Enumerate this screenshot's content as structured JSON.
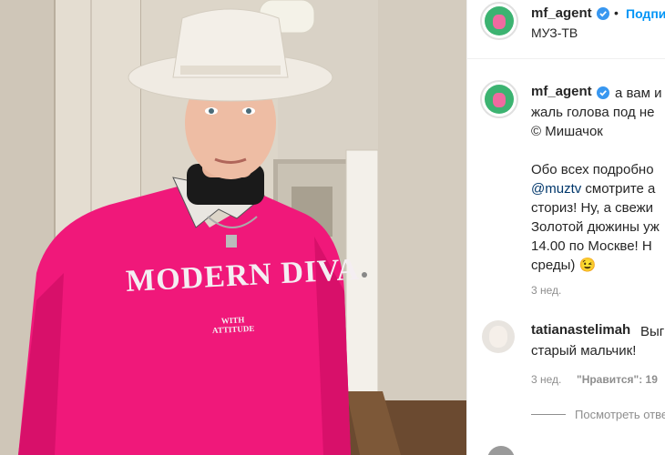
{
  "post_header": {
    "username": "mf_agent",
    "separator": "•",
    "follow_label": "Подпи",
    "location": "МУЗ-ТВ"
  },
  "caption": {
    "username": "mf_agent",
    "line1": "а вам и",
    "line2": "жаль голова под не",
    "line3": "© Мишачок",
    "line4": "Обо всех подробно",
    "mention": "@muztv",
    "line5_rest": " смотрите а",
    "line6": "сториз! Ну, а свежи",
    "line7": "Золотой дюжины уж",
    "line8": "14.00 по Москве! Н",
    "line9": "среды) ",
    "emoji": "😉",
    "time": "3 нед."
  },
  "comment": {
    "username": "tatianastelimah",
    "text_line1": "Выг",
    "text_line2": "старый мальчик!",
    "time": "3 нед.",
    "likes": "\"Нравится\": 19",
    "view_replies": "Посмотреть отве"
  },
  "sweatshirt": {
    "line1": "MODERN DIVA",
    "line2": "WITH",
    "line3": "ATTITUDE"
  },
  "colors": {
    "sweatshirt": "#f0187a",
    "verified": "#3897f0",
    "follow": "#0095f6",
    "link": "#00376b"
  }
}
